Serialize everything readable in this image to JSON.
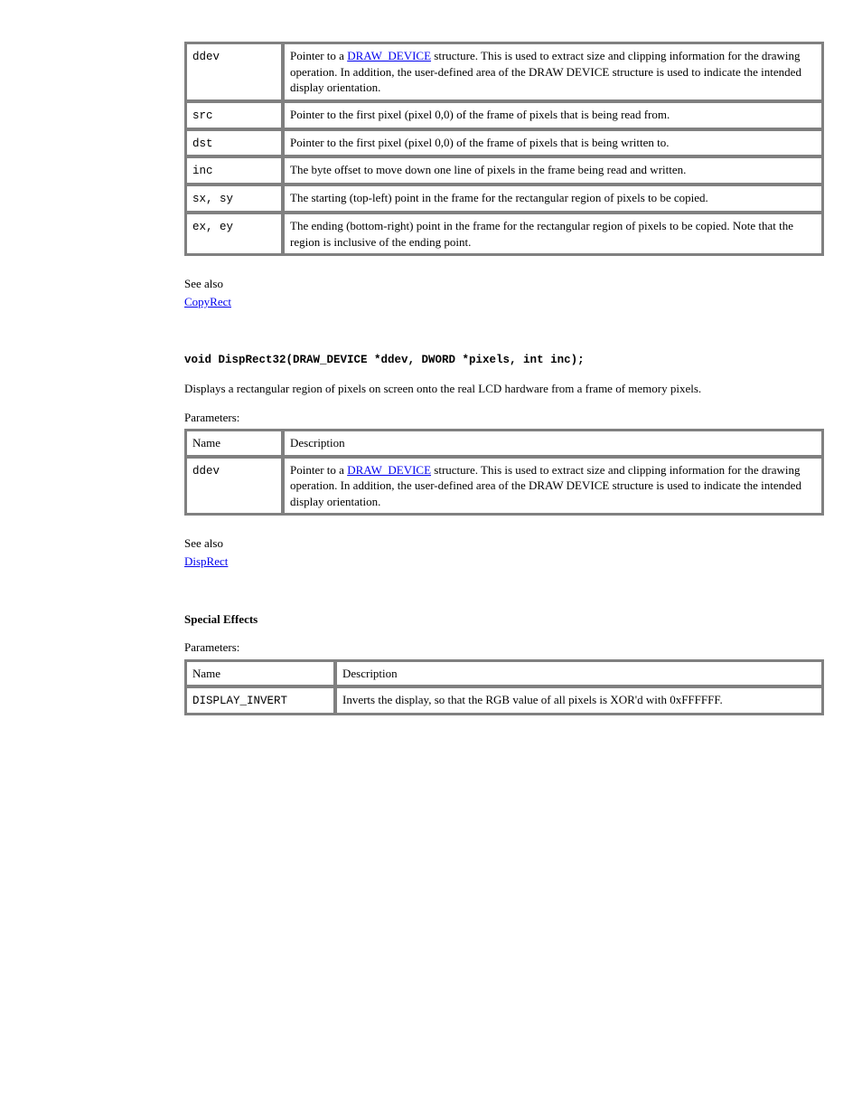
{
  "table1": {
    "rows": [
      {
        "param": "ddev",
        "desc_pre": "Pointer to a ",
        "desc_link": "DRAW_DEVICE",
        "desc_post": " structure. This is used to extract size and clipping information for the drawing operation. In addition, the user-defined area of the DRAW DEVICE structure is used to indicate the intended display orientation."
      },
      {
        "param": "src",
        "desc": "Pointer to the first pixel (pixel 0,0) of the frame of pixels that is being read from."
      },
      {
        "param": "dst",
        "desc": "Pointer to the first pixel (pixel 0,0) of the frame of pixels that is being written to."
      },
      {
        "param": "inc",
        "desc": "The byte offset to move down one line of pixels in the frame being read and written."
      },
      {
        "param": "sx, sy",
        "desc": "The starting (top-left) point in the frame for the rectangular region of pixels to be copied."
      },
      {
        "param": "ex, ey",
        "desc": "The ending (bottom-right) point in the frame for the rectangular region of pixels to be copied. Note that the region is inclusive of the ending point."
      }
    ]
  },
  "seealso1": {
    "label": "See also",
    "link": "CopyRect"
  },
  "decl2": {
    "heading": "void DispRect32(DRAW_DEVICE *ddev, DWORD *pixels, int inc);",
    "desc": "Displays a rectangular region of pixels on screen onto the real LCD hardware from a frame of memory pixels.",
    "params_label": "Parameters:"
  },
  "table2": {
    "rows": [
      {
        "param": "Name",
        "desc": "Description",
        "isHeader": true
      },
      {
        "param": "ddev",
        "desc_pre": "Pointer to a ",
        "desc_link": "DRAW_DEVICE",
        "desc_post": " structure. This is used to extract size and clipping information for the drawing operation. In addition, the user-defined area of the DRAW DEVICE structure is used to indicate the intended display orientation."
      }
    ]
  },
  "seealso2": {
    "label": "See also",
    "link": "DispRect"
  },
  "decl3": {
    "heading": "Special Effects",
    "params_label": "Parameters:"
  },
  "table3": {
    "rows": [
      {
        "param": "Name",
        "desc": "Description",
        "isHeader": true
      },
      {
        "param": "DISPLAY_INVERT",
        "desc": "Inverts the display, so that the RGB value of all pixels is XOR'd with 0xFFFFFF."
      }
    ]
  }
}
